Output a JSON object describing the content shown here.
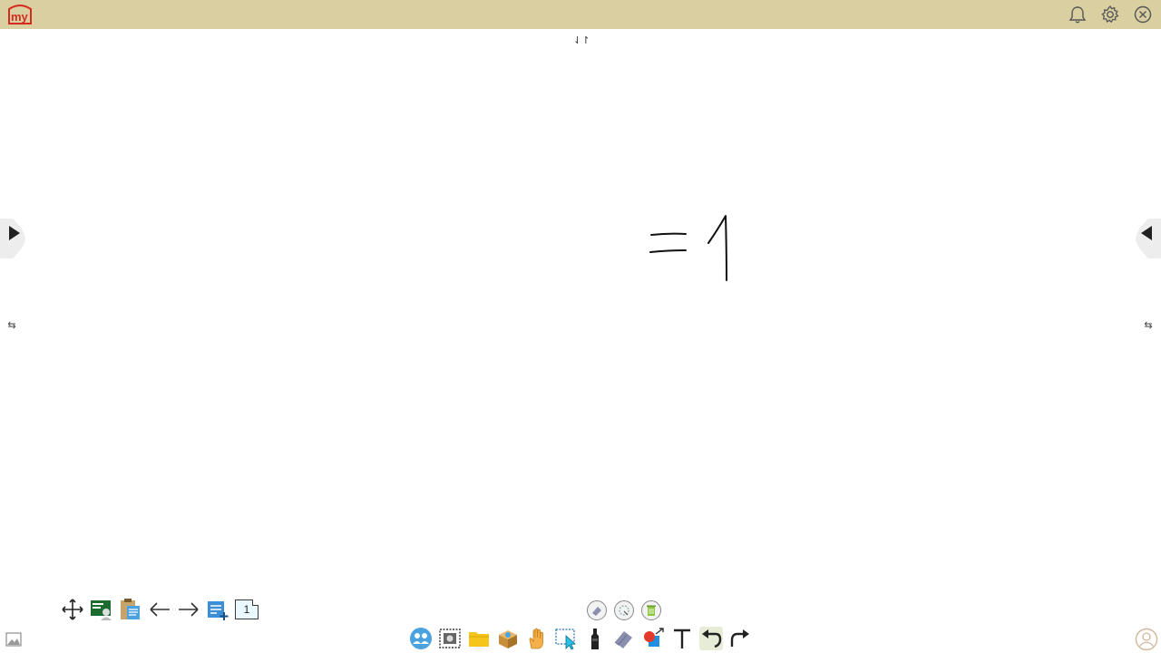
{
  "app": {
    "logo_text": "my",
    "brand_color": "#d62b1f",
    "topbar_color": "#d9cfa1"
  },
  "header": {
    "icons": [
      "bell-icon",
      "gear-icon",
      "close-icon"
    ]
  },
  "canvas": {
    "toggle_symbol": "⇃↾",
    "swap_symbol": "⇆"
  },
  "left_toolbar": {
    "icons": [
      "move-icon",
      "presentation-icon",
      "clipboard-icon",
      "arrow-left-icon",
      "arrow-right-icon",
      "add-page-icon"
    ],
    "page_number": "1"
  },
  "eraser_options": {
    "icons": [
      "eraser-small-icon",
      "eraser-area-icon",
      "trash-icon"
    ]
  },
  "bottom_toolbar": {
    "icons": [
      "users-icon",
      "screenshot-icon",
      "folder-icon",
      "box-icon",
      "hand-icon",
      "select-icon",
      "marker-icon",
      "eraser-icon",
      "shapes-icon",
      "text-icon",
      "undo-icon",
      "redo-icon"
    ],
    "active": "undo-icon"
  }
}
